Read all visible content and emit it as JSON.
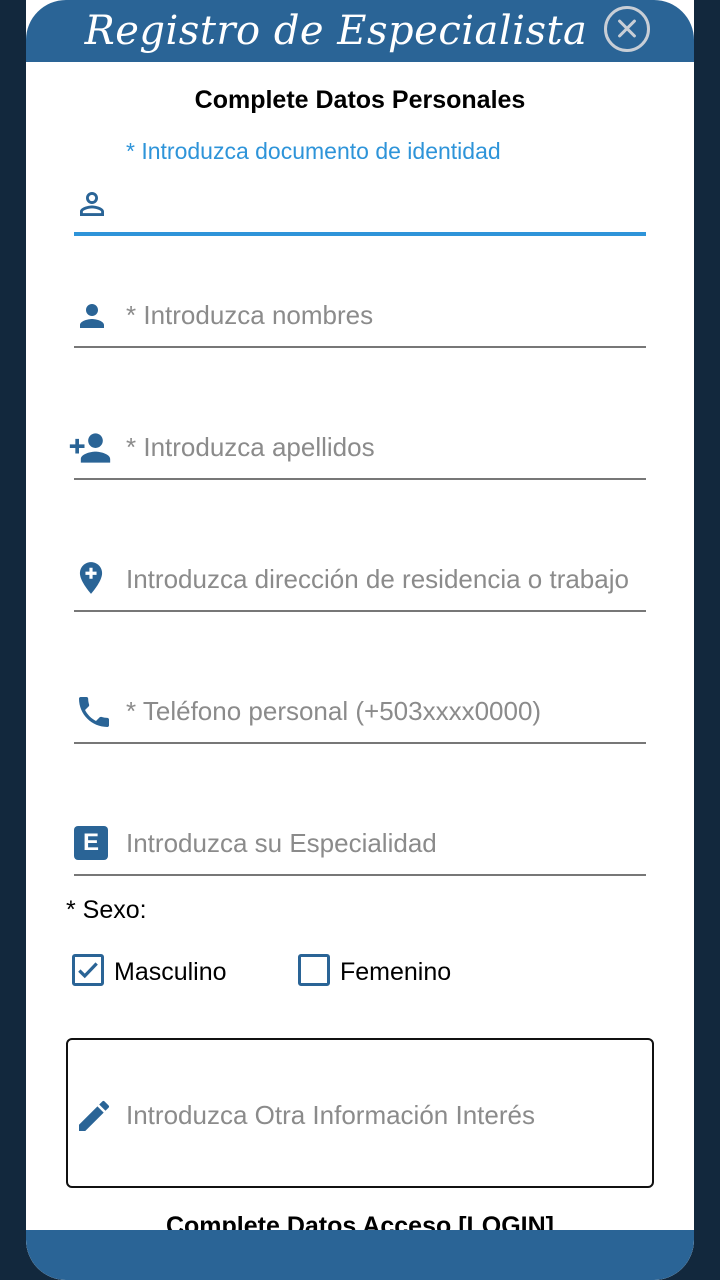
{
  "header": {
    "title": "Registro de Especialista"
  },
  "personal": {
    "section_title": "Complete Datos Personales",
    "document": {
      "label": "* Introduzca documento de identidad",
      "value": ""
    },
    "names": {
      "placeholder": "* Introduzca nombres"
    },
    "surnames": {
      "placeholder": "* Introduzca apellidos"
    },
    "address": {
      "placeholder": "Introduzca dirección de residencia o trabajo"
    },
    "phone": {
      "placeholder": "* Teléfono personal (+503xxxx0000)"
    },
    "specialty": {
      "placeholder": "Introduzca su Especialidad",
      "icon_letter": "E"
    },
    "sex": {
      "label": "* Sexo:",
      "options": [
        {
          "label": "Masculino",
          "checked": true
        },
        {
          "label": "Femenino",
          "checked": false
        }
      ]
    },
    "other_info": {
      "placeholder": "Introduzca Otra Información Interés"
    }
  },
  "access": {
    "section_title": "Complete Datos Acceso [LOGIN]"
  },
  "icons": [
    "close-icon",
    "person-outline-icon",
    "person-icon",
    "person-add-icon",
    "location-add-icon",
    "phone-icon",
    "letter-e-icon",
    "checkbox-checked-icon",
    "checkbox-empty-icon",
    "pencil-icon"
  ],
  "colors": {
    "primary": "#2a6496",
    "accent": "#2e94d9",
    "background": "#12283d"
  }
}
